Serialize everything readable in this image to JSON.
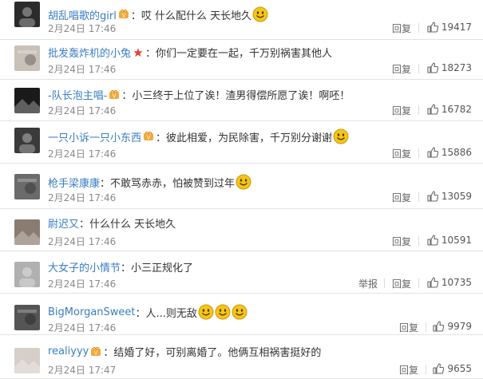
{
  "comments": [
    {
      "name": "胡乱唱歌的girl",
      "sep": "：",
      "text": "哎 什么配什么 天长地久",
      "time": "2月24日 17:46",
      "reply": "回复",
      "likes": "19417",
      "has_badge": true,
      "smiles": 1,
      "avatar_color": "#2b2b2b"
    },
    {
      "name": "批发轰炸机的小兔",
      "sep": "：",
      "text": "你们一定要在一起，千万别祸害其他人",
      "time": "2月24日 17:46",
      "reply": "回复",
      "likes": "18273",
      "has_badge": false,
      "has_star": true,
      "smiles": 0,
      "avatar_color": "#c9c0b8"
    },
    {
      "name": "-队长泡主唱-",
      "sep": "：",
      "text": "小三终于上位了诶！渣男得偿所愿了诶！啊呸！",
      "time": "2月24日 17:46",
      "reply": "回复",
      "likes": "16782",
      "has_badge": true,
      "smiles": 0,
      "avatar_color": "#1a1a1a"
    },
    {
      "name": "一只小诉一只小东西",
      "sep": "：",
      "text": "彼此相爱，为民除害，千万别分谢谢",
      "time": "2月24日 17:46",
      "reply": "回复",
      "likes": "15886",
      "has_badge": true,
      "smiles": 1,
      "avatar_color": "#3a3a3a"
    },
    {
      "name": "枪手梁康康",
      "sep": "：",
      "text": "不敢骂赤赤，怕被赞到过年",
      "time": "2月24日 17:46",
      "reply": "回复",
      "likes": "13059",
      "has_badge": false,
      "smiles": 1,
      "avatar_color": "#6b6b6b"
    },
    {
      "name": "尉迟又",
      "sep": "：",
      "text": "什么什么 天长地久",
      "time": "2月24日 17:46",
      "reply": "回复",
      "likes": "10591",
      "has_badge": false,
      "smiles": 0,
      "avatar_color": "#8a7c70"
    },
    {
      "name": "大女子的小情节",
      "sep": "：",
      "text": "小三正规化了",
      "time": "2月24日 17:46",
      "report": "举报",
      "reply": "回复",
      "likes": "10735",
      "has_badge": false,
      "smiles": 0,
      "avatar_color": "#b0b0b0"
    },
    {
      "name": "BigMorganSweet",
      "sep": "：",
      "text": "人...则无敌",
      "time": "2月24日 17:46",
      "reply": "回复",
      "likes": "9979",
      "has_badge": false,
      "smiles": 3,
      "avatar_color": "#555555"
    },
    {
      "name": "realiyyy",
      "sep": "：",
      "text": "结婚了好，可别离婚了。他俩互相祸害挺好的",
      "time": "2月24日 17:47",
      "reply": "回复",
      "likes": "9655",
      "has_badge": true,
      "smiles": 0,
      "avatar_color": "#d6cfc8"
    }
  ],
  "icons": {
    "thumb": "thumbs-up-icon",
    "smile": "smile-emoji-icon",
    "badge": "vip-badge-icon",
    "star": "star-icon"
  },
  "colors": {
    "name": "#3a7dc3",
    "time": "#8a8a8a",
    "divider": "#e3e3e3",
    "emoji": "#f5c518"
  }
}
